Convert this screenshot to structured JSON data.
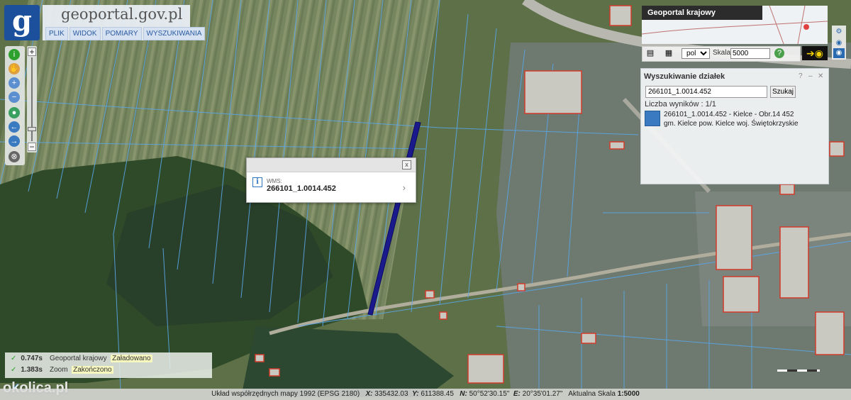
{
  "logo": {
    "letter": "g",
    "site": "geoportal.gov.pl"
  },
  "menu": [
    "PLIK",
    "WIDOK",
    "POMIARY",
    "WYSZUKIWANIA"
  ],
  "overview": {
    "title": "Geoportal krajowy"
  },
  "toolbar": {
    "language": "pol",
    "scale_label": "Skala:",
    "scale_value": "5000"
  },
  "search_panel": {
    "title": "Wyszukiwanie działek",
    "help": "?",
    "minimize": "–",
    "close": "✕",
    "query": "266101_1.0014.452",
    "button": "Szukaj",
    "result_count": "Liczba wyników : 1/1",
    "result_line1": "266101_1.0014.452 - Kielce - Obr.14 452",
    "result_line2": "gm. Kielce pow. Kielce woj. Świętokrzyskie"
  },
  "popup": {
    "close": "x",
    "layer": "WMS:",
    "value": "266101_1.0014.452"
  },
  "status": [
    {
      "time": "0.747s",
      "source": "Geoportal krajowy",
      "message": "Załadowano"
    },
    {
      "time": "1.383s",
      "source": "Zoom",
      "message": "Zakończono"
    }
  ],
  "watermark": "okolica.pl",
  "footer": {
    "system": "Układ współrzędnych mapy 1992 (EPSG 2180)",
    "x_label": "X:",
    "x_value": "335432.03",
    "y_label": "Y:",
    "y_value": "611388.45",
    "n_label": "N:",
    "n_value": "50°52'30.15\"",
    "e_label": "E:",
    "e_value": "20°35'01.27\"",
    "scale_label": "Aktualna Skala",
    "scale_value": "1:5000"
  },
  "colors": {
    "parcel_lines": "#5aa6e8",
    "selected_parcel": "#1a1a8c",
    "buildings": "#d23a2a",
    "logo_bg": "#1c4f9c"
  },
  "icons": {
    "nav": [
      "info-icon",
      "pan-hand-icon",
      "zoom-in-icon",
      "zoom-out-icon",
      "full-extent-icon",
      "back-arrow-icon",
      "forward-arrow-icon",
      "measure-icon"
    ],
    "toolbar": [
      "print-icon",
      "save-icon",
      "help-icon",
      "visibility-eye-icon"
    ]
  }
}
